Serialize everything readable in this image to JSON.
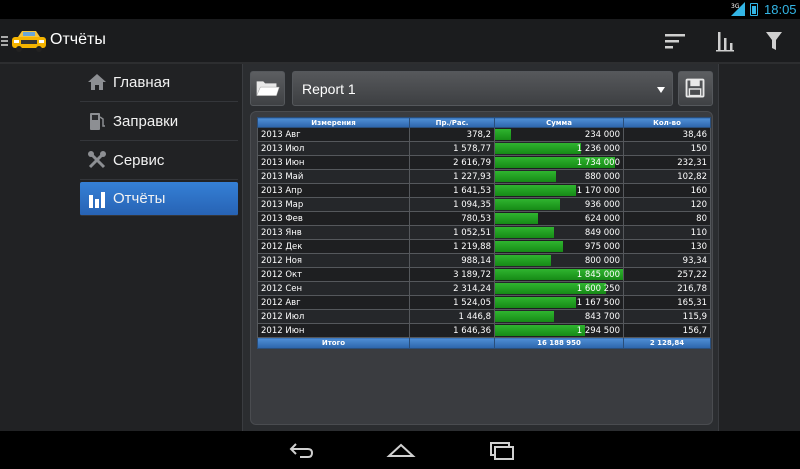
{
  "status_bar": {
    "time": "18:05",
    "signal_label": "3G"
  },
  "action_bar": {
    "title": "Отчёты"
  },
  "sidebar": {
    "items": [
      {
        "label": "Главная",
        "icon": "home-icon",
        "active": false
      },
      {
        "label": "Заправки",
        "icon": "fuel-pump-icon",
        "active": false
      },
      {
        "label": "Сервис",
        "icon": "tools-icon",
        "active": false
      },
      {
        "label": "Отчёты",
        "icon": "bar-chart-icon",
        "active": true
      }
    ]
  },
  "report": {
    "selected": "Report 1"
  },
  "table": {
    "columns": [
      "Измерения",
      "Пр./Рас.",
      "Сумма",
      "Кол-во"
    ],
    "rows": [
      {
        "dim": "2013 Авг",
        "rate": "378,2",
        "sum": "234 000",
        "sum_value": 234000,
        "qty": "38,46"
      },
      {
        "dim": "2013 Июл",
        "rate": "1 578,77",
        "sum": "1 236 000",
        "sum_value": 1236000,
        "qty": "150"
      },
      {
        "dim": "2013 Июн",
        "rate": "2 616,79",
        "sum": "1 734 000",
        "sum_value": 1734000,
        "qty": "232,31"
      },
      {
        "dim": "2013 Май",
        "rate": "1 227,93",
        "sum": "880 000",
        "sum_value": 880000,
        "qty": "102,82"
      },
      {
        "dim": "2013 Апр",
        "rate": "1 641,53",
        "sum": "1 170 000",
        "sum_value": 1170000,
        "qty": "160"
      },
      {
        "dim": "2013 Мар",
        "rate": "1 094,35",
        "sum": "936 000",
        "sum_value": 936000,
        "qty": "120"
      },
      {
        "dim": "2013 Фев",
        "rate": "780,53",
        "sum": "624 000",
        "sum_value": 624000,
        "qty": "80"
      },
      {
        "dim": "2013 Янв",
        "rate": "1 052,51",
        "sum": "849 000",
        "sum_value": 849000,
        "qty": "110"
      },
      {
        "dim": "2012 Дек",
        "rate": "1 219,88",
        "sum": "975 000",
        "sum_value": 975000,
        "qty": "130"
      },
      {
        "dim": "2012 Ноя",
        "rate": "988,14",
        "sum": "800 000",
        "sum_value": 800000,
        "qty": "93,34"
      },
      {
        "dim": "2012 Окт",
        "rate": "3 189,72",
        "sum": "1 845 000",
        "sum_value": 1845000,
        "qty": "257,22"
      },
      {
        "dim": "2012 Сен",
        "rate": "2 314,24",
        "sum": "1 600 250",
        "sum_value": 1600250,
        "qty": "216,78"
      },
      {
        "dim": "2012 Авг",
        "rate": "1 524,05",
        "sum": "1 167 500",
        "sum_value": 1167500,
        "qty": "165,31"
      },
      {
        "dim": "2012 Июл",
        "rate": "1 446,8",
        "sum": "843 700",
        "sum_value": 843700,
        "qty": "115,9"
      },
      {
        "dim": "2012 Июн",
        "rate": "1 646,36",
        "sum": "1 294 500",
        "sum_value": 1294500,
        "qty": "156,7"
      }
    ],
    "total": {
      "label": "Итого",
      "rate": "",
      "sum": "16 188 950",
      "qty": "2 128,84"
    },
    "bar_color": "#2aa52a"
  },
  "colors": {
    "accent": "#33b5e5",
    "active_nav": "#2f74c8",
    "header_blue": "#3d7cc4"
  }
}
